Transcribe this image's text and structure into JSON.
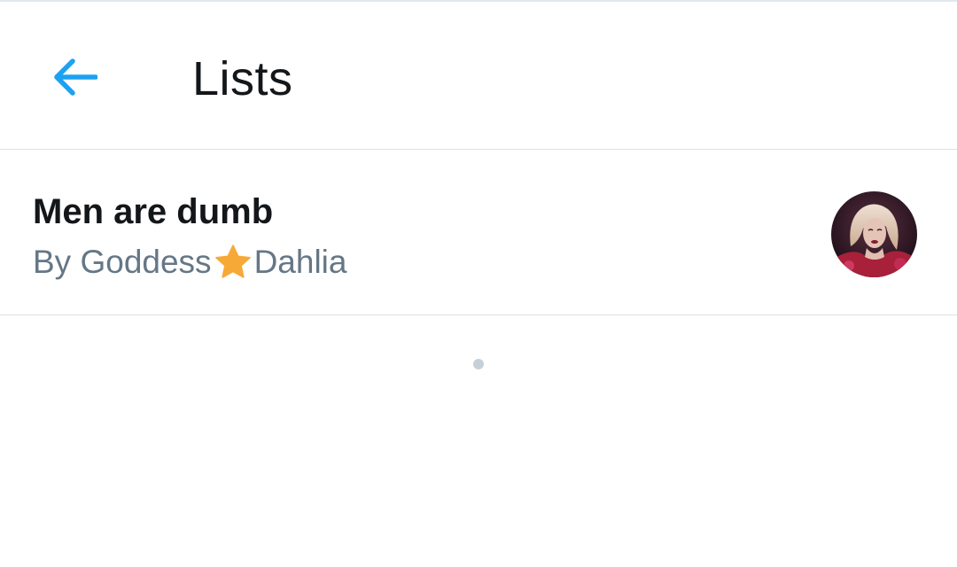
{
  "header": {
    "back_icon": "arrow-left-icon",
    "title": "Lists"
  },
  "lists": [
    {
      "name": "Men are dumb",
      "owner_prefix": "By Goddess",
      "owner_star": "star-icon",
      "owner_suffix": "Dahlia",
      "avatar": "owner-avatar"
    }
  ],
  "colors": {
    "accent": "#1da1f2",
    "text_primary": "#14171a",
    "text_secondary": "#657786",
    "divider": "#dce2e7",
    "star": "#f7a938"
  }
}
